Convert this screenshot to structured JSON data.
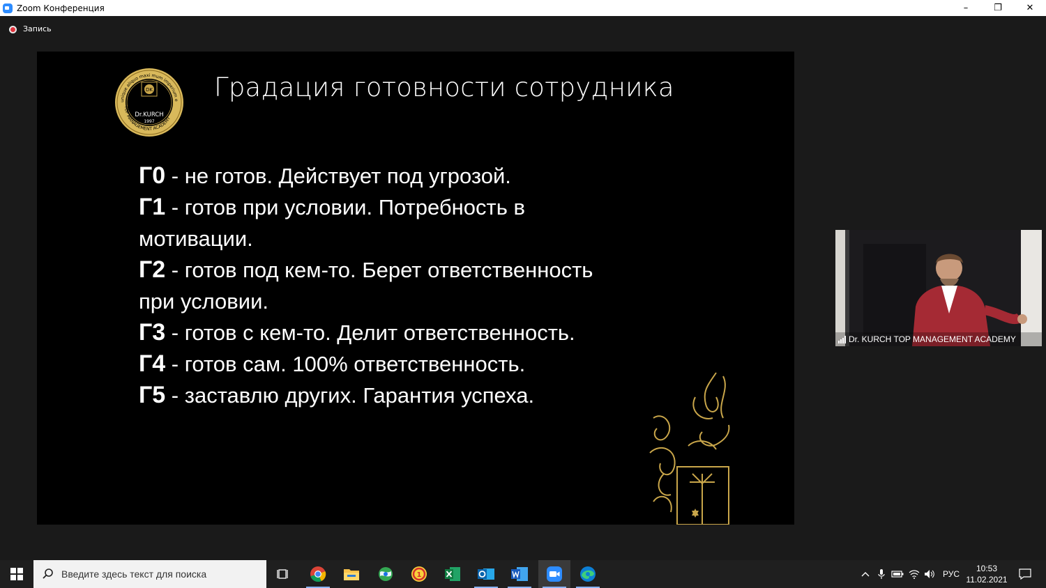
{
  "window": {
    "title": "Zoom Конференция",
    "minimize": "–",
    "restore": "❐",
    "close": "✕"
  },
  "recording": {
    "label": "Запись"
  },
  "slide": {
    "title": "Градация готовности сотрудника",
    "logo_text": {
      "name": "Dr.KURCH",
      "year": "1997",
      "ring_bottom": "TOP MANAGEMENT ACADEMY",
      "ring_top": "unique aliquo maxi mum imperium est",
      "monogram": "DK"
    },
    "lines": [
      {
        "code": "Г0",
        "text": " - не готов. Действует под угрозой."
      },
      {
        "code": "Г1",
        "text": " - готов при условии. Потребность в"
      },
      {
        "code": "",
        "text": "мотивации."
      },
      {
        "code": "Г2",
        "text": " - готов под кем-то. Берет ответственность"
      },
      {
        "code": "",
        "text": "при условии."
      },
      {
        "code": "Г3",
        "text": " - готов с кем-то. Делит ответственность."
      },
      {
        "code": "Г4",
        "text": " - готов сам. 100% ответственность."
      },
      {
        "code": "Г5",
        "text": " - заставлю других. Гарантия успеха."
      }
    ]
  },
  "video": {
    "participant_name": "Dr. KURCH TOP MANAGEMENT ACADEMY"
  },
  "taskbar": {
    "search_placeholder": "Введите здесь текст для поиска",
    "apps": [
      "task-view-icon",
      "chrome-icon",
      "file-explorer-icon",
      "maps-icon",
      "1c-icon",
      "excel-icon",
      "outlook-icon",
      "word-icon",
      "zoom-icon",
      "edge-icon"
    ],
    "language": "РУС",
    "time": "10:53",
    "date": "11.02.2021"
  },
  "colors": {
    "accent_gold": "#c9a64a",
    "zoom_blue": "#2d8cff",
    "slide_bg": "#000000"
  }
}
